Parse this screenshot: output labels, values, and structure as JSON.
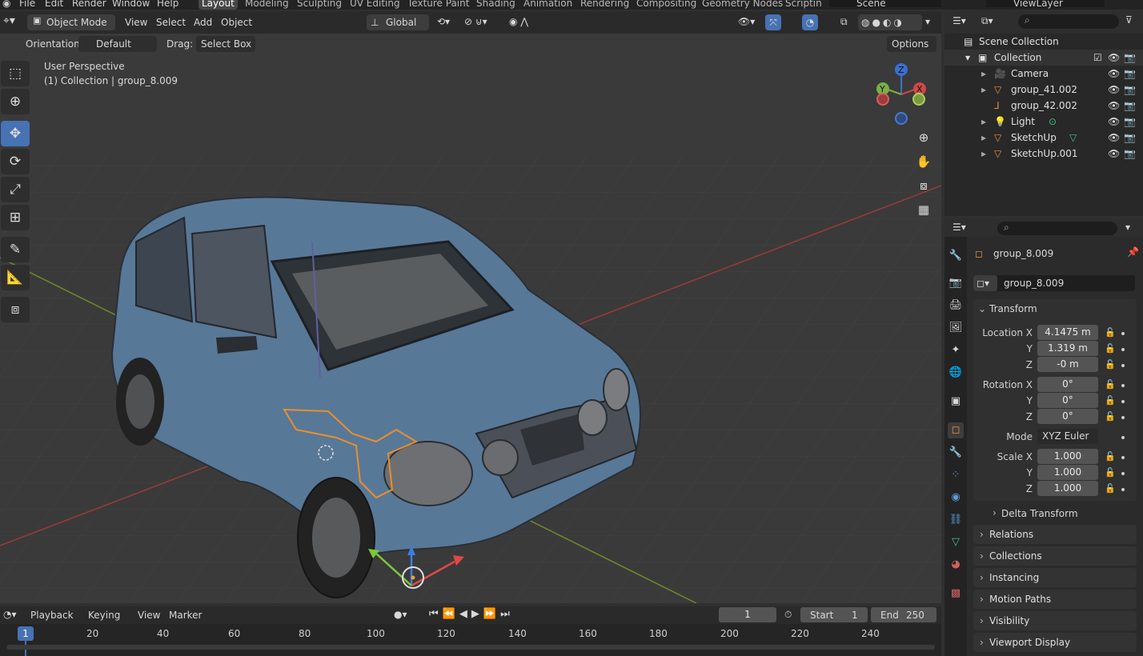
{
  "menu": [
    "File",
    "Edit",
    "Render",
    "Window",
    "Help"
  ],
  "workspaces": [
    "Layout",
    "Modeling",
    "Sculpting",
    "UV Editing",
    "Texture Paint",
    "Shading",
    "Animation",
    "Rendering",
    "Compositing",
    "Geometry Nodes",
    "Scripting"
  ],
  "scene_name": "Scene",
  "viewlayer_name": "ViewLayer",
  "viewport_header": {
    "mode": "Object Mode",
    "menus": [
      "View",
      "Select",
      "Add",
      "Object"
    ],
    "transform_orientation": "Global",
    "orientation_label": "Orientation:",
    "orientation_value": "Default",
    "drag_label": "Drag:",
    "drag_value": "Select Box",
    "options": "Options"
  },
  "viewport": {
    "view_name": "User Perspective",
    "collection_info": "(1) Collection | group_8.009",
    "gizmo_axes": [
      "Z",
      "Y",
      "X"
    ]
  },
  "outliner": {
    "root": "Scene Collection",
    "collection": "Collection",
    "items": [
      {
        "name": "Camera",
        "icon": "camera-icon"
      },
      {
        "name": "group_41.002",
        "icon": "mesh-icon"
      },
      {
        "name": "group_42.002",
        "icon": "empty-icon"
      },
      {
        "name": "Light",
        "icon": "light-icon"
      },
      {
        "name": "SketchUp",
        "icon": "mesh-icon"
      },
      {
        "name": "SketchUp.001",
        "icon": "mesh-icon"
      }
    ]
  },
  "properties": {
    "object_name": "group_8.009",
    "datablock_name": "group_8.009",
    "transform_title": "Transform",
    "location": {
      "label": "Location X",
      "x": "4.1475 m",
      "y": "1.319 m",
      "z": "-0 m"
    },
    "rotation": {
      "label": "Rotation X",
      "x": "0°",
      "y": "0°",
      "z": "0°"
    },
    "mode_label": "Mode",
    "mode_value": "XYZ Euler",
    "scale": {
      "label": "Scale X",
      "x": "1.000",
      "y": "1.000",
      "z": "1.000"
    },
    "axis_labels": {
      "y": "Y",
      "z": "Z"
    },
    "delta": "Delta Transform",
    "panels": [
      "Relations",
      "Collections",
      "Instancing",
      "Motion Paths",
      "Visibility",
      "Viewport Display"
    ]
  },
  "timeline": {
    "menus": [
      "Playback",
      "Keying",
      "View",
      "Marker"
    ],
    "current_frame": "1",
    "start_label": "Start",
    "start": "1",
    "end_label": "End",
    "end": "250",
    "frames": [
      "20",
      "40",
      "60",
      "80",
      "100",
      "120",
      "140",
      "160",
      "180",
      "200",
      "220",
      "240"
    ]
  }
}
